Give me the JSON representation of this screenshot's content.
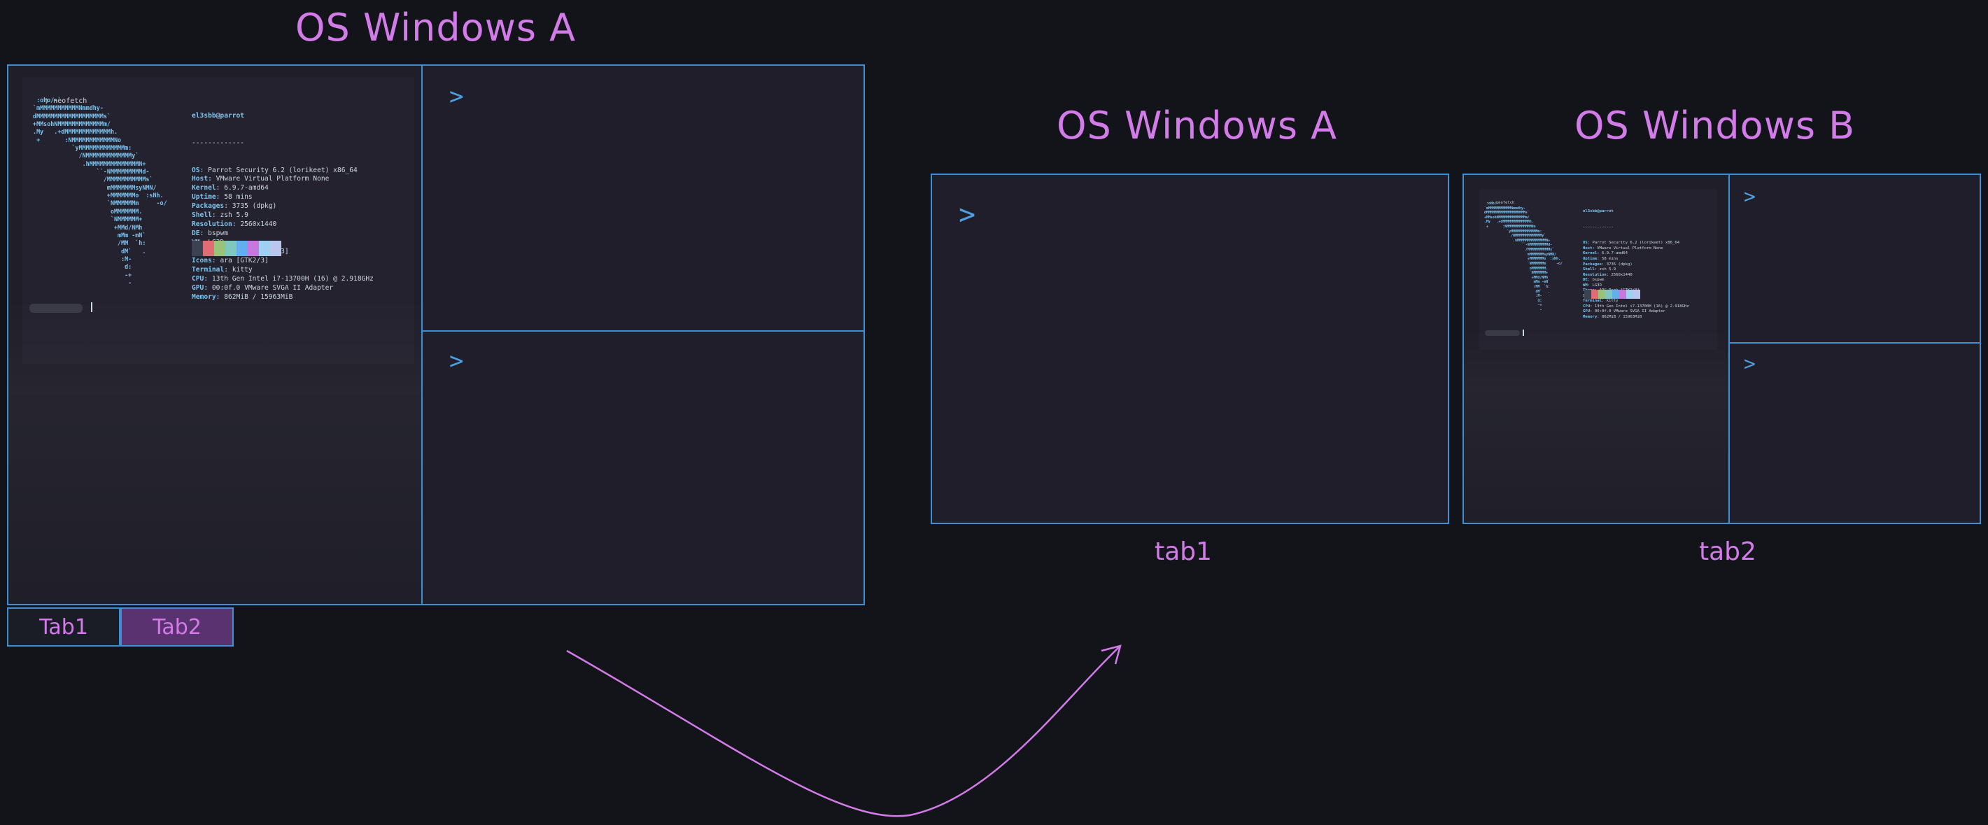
{
  "left_diagram": {
    "title": "OS Windows A",
    "terminal": {
      "prompt_command": "neofetch",
      "art_lines": [
        "  :oho/-`",
        " `mMMMMMMMMMMMNmmdhy-",
        " dMMMMMMMMMMMMMMMMMMMs`",
        " +MMsohNMMMMMMMMMMMMMm/",
        " .My   .+dMMMMMMMMMMMMMh.",
        "  +       :NMMMMMMMMMMMMNo",
        "            `yMMMMMMMMMMMMMm:",
        "              /NMMMMMMMMMMMMMy`",
        "               .hMMMMMMMMMMMMMMN+",
        "                   ``-NMMMMMMMMMd-",
        "                     /MMMMMMMMMMMs`",
        "                      mMMMMMMMsyNMN/",
        "                      +MMMMMMMo  :sNh.",
        "                      `NMMMMMMm     -o/",
        "                       oMMMMMMM.",
        "                       `NMMMMMM+",
        "                        +MMd/NMh",
        "                         mMm -mN`",
        "                         /MM  `h:",
        "                          dM`   .",
        "                          :M-",
        "                           d:",
        "                           -+",
        "                            -"
      ],
      "user_host": "el3sbb@parrot",
      "separator": "-------------",
      "info": [
        {
          "key": "OS",
          "value": "Parrot Security 6.2 (lorikeet) x86_64"
        },
        {
          "key": "Host",
          "value": "VMware Virtual Platform None"
        },
        {
          "key": "Kernel",
          "value": "6.9.7-amd64"
        },
        {
          "key": "Uptime",
          "value": "58 mins"
        },
        {
          "key": "Packages",
          "value": "3735 (dpkg)"
        },
        {
          "key": "Shell",
          "value": "zsh 5.9"
        },
        {
          "key": "Resolution",
          "value": "2560x1440"
        },
        {
          "key": "DE",
          "value": "bspwm"
        },
        {
          "key": "WM",
          "value": "LG3D"
        },
        {
          "key": "Theme",
          "value": "ARC-Dark [GTK2/3]"
        },
        {
          "key": "Icons",
          "value": "ara [GTK2/3]"
        },
        {
          "key": "Terminal",
          "value": "kitty"
        },
        {
          "key": "CPU",
          "value": "13th Gen Intel i7-13700H (16) @ 2.918GHz"
        },
        {
          "key": "GPU",
          "value": "00:0f.0 VMware SVGA II Adapter"
        },
        {
          "key": "Memory",
          "value": "862MiB / 15963MiB"
        }
      ],
      "palette": [
        "#3b4252",
        "#e06c75",
        "#98c379",
        "#7fc8c0",
        "#61afef",
        "#c678dd",
        "#9fd0f0",
        "#b9c6ee"
      ]
    },
    "pane_prompt": ">",
    "tabs": [
      {
        "label": "Tab1",
        "active": false
      },
      {
        "label": "Tab2",
        "active": true
      }
    ]
  },
  "right_a": {
    "title": "OS Windows A",
    "pane_prompt": ">",
    "caption": "tab1"
  },
  "right_b": {
    "title": "OS Windows B",
    "pane_prompt": ">",
    "caption": "tab2"
  },
  "colors": {
    "accent_text": "#d27be9",
    "border": "#3d8fd1",
    "pane_bg": "#1f1e2a",
    "background": "#121419",
    "active_tab_bg": "#5a3270"
  }
}
